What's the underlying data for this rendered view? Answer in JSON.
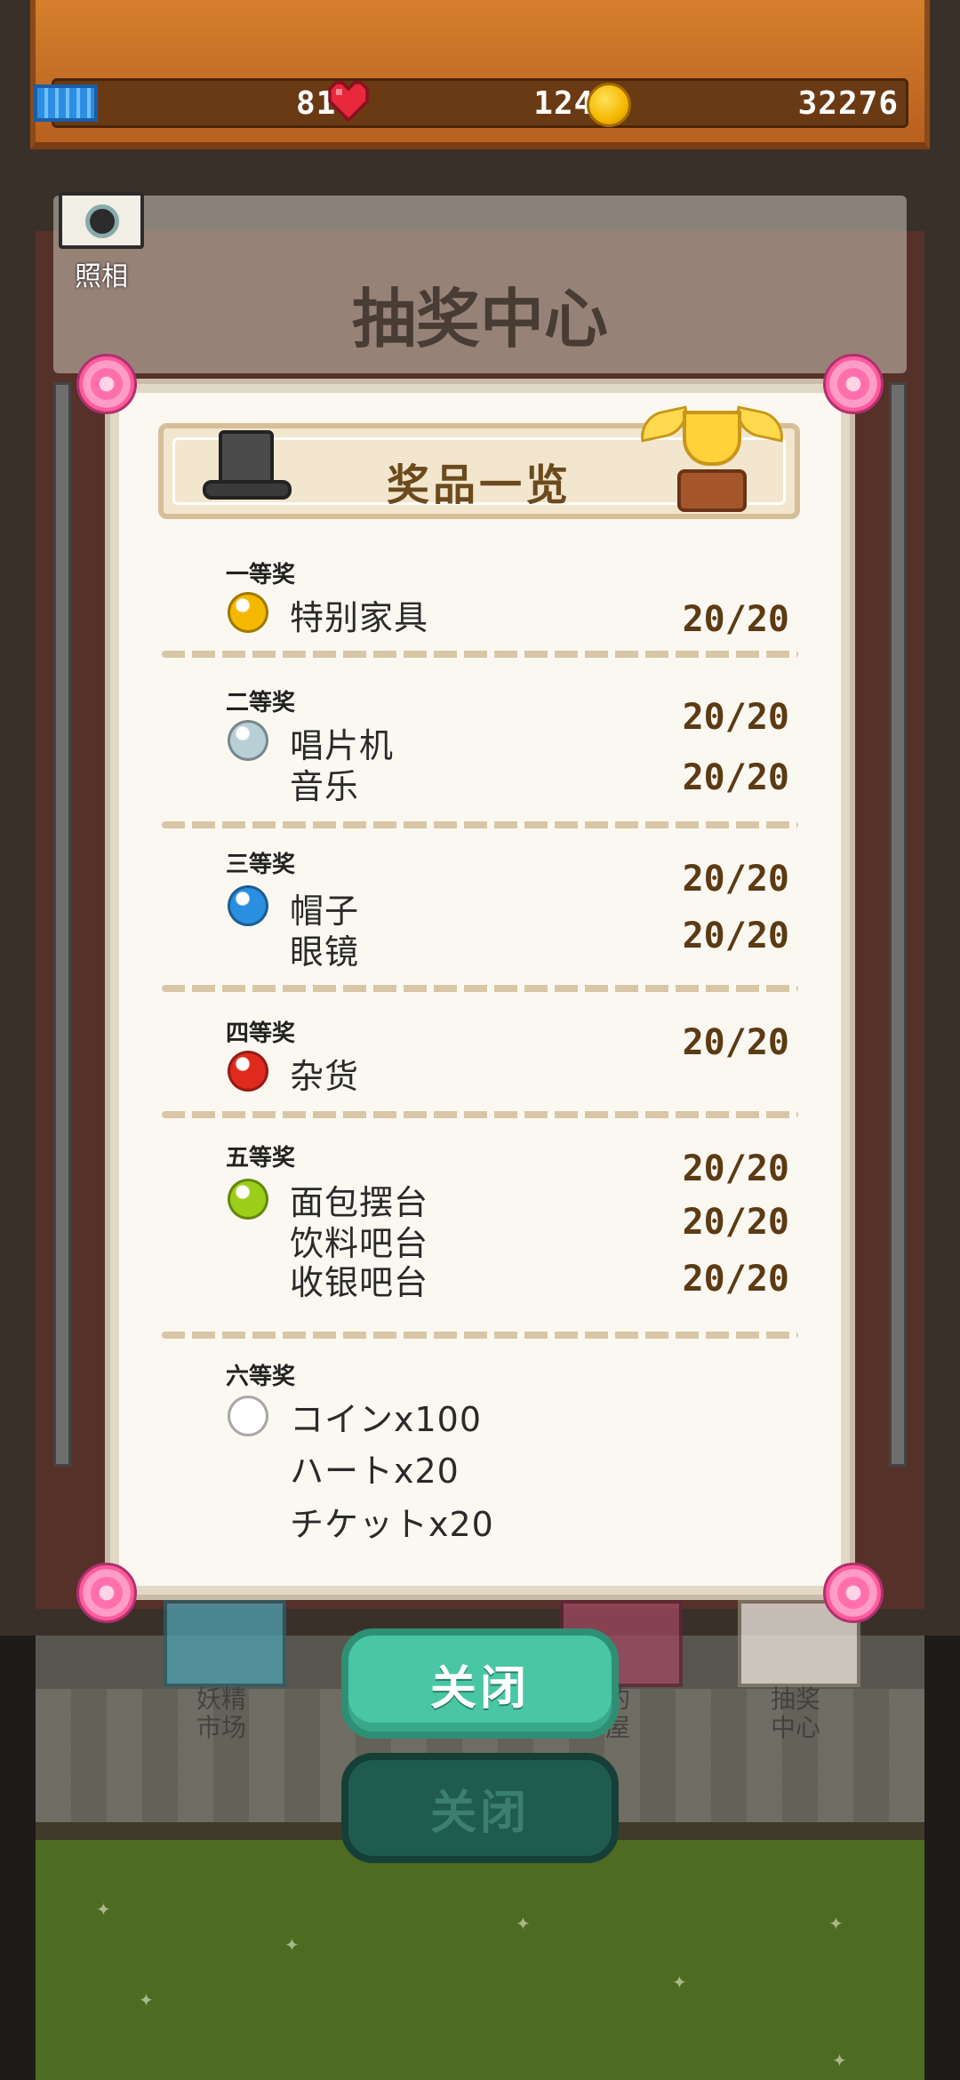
{
  "hud": {
    "tickets": "819",
    "hearts": "1241",
    "coins": "32276"
  },
  "camera": {
    "label": "照相"
  },
  "store_title": "抽奖中心",
  "modal": {
    "title": "奖品一览",
    "tiers": [
      {
        "label": "一等奖",
        "gem_color": "#f5b800",
        "items": [
          {
            "name": "特别家具",
            "count": "20/20"
          }
        ]
      },
      {
        "label": "二等奖",
        "gem_color": "#b9cfd6",
        "items": [
          {
            "name": "唱片机",
            "count": "20/20"
          },
          {
            "name": "音乐",
            "count": "20/20"
          }
        ]
      },
      {
        "label": "三等奖",
        "gem_color": "#2b8fe0",
        "items": [
          {
            "name": "帽子",
            "count": "20/20"
          },
          {
            "name": "眼镜",
            "count": "20/20"
          }
        ]
      },
      {
        "label": "四等奖",
        "gem_color": "#e12a1e",
        "items": [
          {
            "name": "杂货",
            "count": "20/20"
          }
        ]
      },
      {
        "label": "五等奖",
        "gem_color": "#9ccf1a",
        "items": [
          {
            "name": "面包摆台",
            "count": "20/20"
          },
          {
            "name": "饮料吧台",
            "count": "20/20"
          },
          {
            "name": "收银吧台",
            "count": "20/20"
          }
        ]
      },
      {
        "label": "六等奖",
        "gem_color": "#ffffff",
        "items": [
          {
            "name": "コインx100"
          },
          {
            "name": "ハートx20"
          },
          {
            "name": "チケットx20"
          }
        ]
      }
    ]
  },
  "buttons": {
    "close": "关闭",
    "close_ghost": "关闭"
  },
  "background_shops": [
    {
      "label_line1": "妖精",
      "label_line2": "市场"
    },
    {
      "label_line1": "的",
      "label_line2": "屋"
    },
    {
      "label_line1": "抽奖",
      "label_line2": "中心"
    }
  ]
}
